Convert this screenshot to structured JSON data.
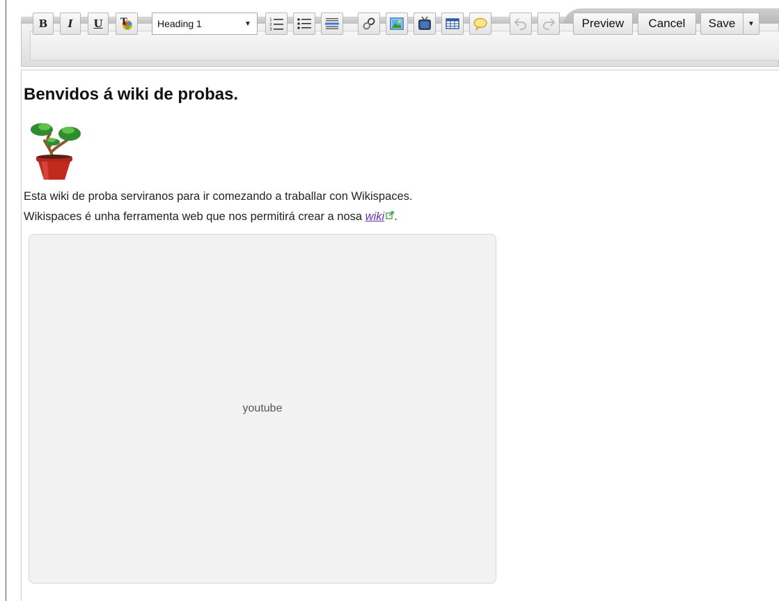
{
  "toolbar": {
    "format_buttons": [
      {
        "label": "B",
        "name": "bold"
      },
      {
        "label": "I",
        "name": "italic"
      },
      {
        "label": "U",
        "name": "underline"
      }
    ],
    "style_select": {
      "value": "Heading 1"
    },
    "preview_label": "Preview",
    "cancel_label": "Cancel",
    "save_label": "Save",
    "icons": [
      "text-color-icon",
      "numbered-list-icon",
      "bulleted-list-icon",
      "horizontal-rule-icon",
      "link-icon",
      "image-icon",
      "widget-icon",
      "table-icon",
      "comment-icon",
      "undo-icon",
      "redo-icon",
      "chevron-down-icon"
    ]
  },
  "content": {
    "heading": "Benvidos á wiki de probas.",
    "paragraph1": "Esta wiki de proba serviranos para ir comezando a traballar con Wikispaces.",
    "paragraph2_prefix": "Wikispaces é unha ferramenta web que nos permitirá crear a nosa ",
    "paragraph2_link": "wiki",
    "paragraph2_suffix": ".",
    "embed_label": "youtube"
  },
  "colors": {
    "link": "#6b2fb3",
    "content_border": "#c8cbe6",
    "embed_background": "#f2f2f2"
  }
}
